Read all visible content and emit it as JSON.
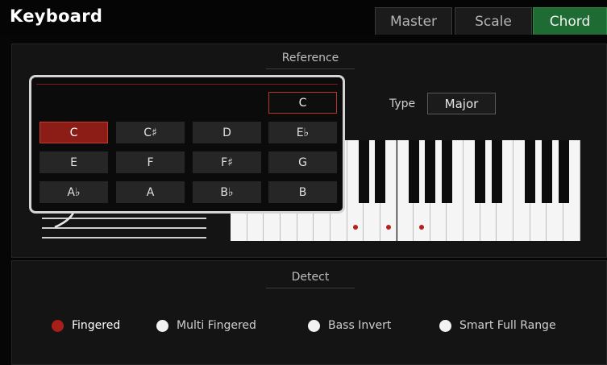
{
  "header": {
    "title": "Keyboard",
    "tabs": [
      "Master",
      "Scale",
      "Chord"
    ],
    "active_tab": "Chord"
  },
  "reference": {
    "label": "Reference",
    "type_label": "Type",
    "type_value": "Major",
    "marked_notes": [
      "C",
      "E",
      "G"
    ]
  },
  "note_picker": {
    "current_root": "C",
    "selected_note": "C",
    "rows": [
      [
        "C",
        "C#",
        "D",
        "Eb"
      ],
      [
        "E",
        "F",
        "F#",
        "G"
      ],
      [
        "Ab",
        "A",
        "Bb",
        "B"
      ]
    ],
    "labels": {
      "C": "C",
      "C#": "C♯",
      "D": "D",
      "Eb": "E♭",
      "E": "E",
      "F": "F",
      "F#": "F♯",
      "G": "G",
      "Ab": "A♭",
      "A": "A",
      "Bb": "B♭",
      "B": "B"
    }
  },
  "detect": {
    "label": "Detect",
    "options": [
      {
        "label": "Fingered",
        "checked": true
      },
      {
        "label": "Multi Fingered",
        "checked": false
      },
      {
        "label": "Bass Invert",
        "checked": false
      },
      {
        "label": "Smart Full Range",
        "checked": false
      }
    ]
  },
  "colors": {
    "accent_green": "#1f6b34",
    "accent_red": "#a81f19"
  }
}
